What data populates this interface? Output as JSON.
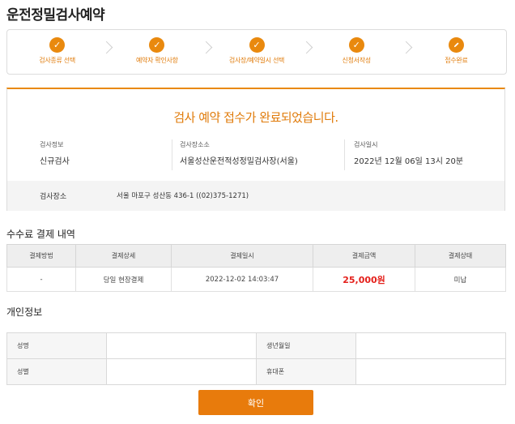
{
  "page_title": "운전정밀검사예약",
  "steps": [
    {
      "label": "검사종류 선택",
      "icon": "check-icon"
    },
    {
      "label": "예약자 확인사항",
      "icon": "check-icon"
    },
    {
      "label": "검사장/예약일시 선택",
      "icon": "check-icon"
    },
    {
      "label": "신청서작성",
      "icon": "check-icon"
    },
    {
      "label": "접수완료",
      "icon": "pencil-icon"
    }
  ],
  "result": {
    "headline": "검사 예약 접수가 완료되었습니다.",
    "info": [
      {
        "key": "검사정보",
        "value": "신규검사"
      },
      {
        "key": "검사장소소",
        "value": "서울성산운전적성정밀검사장(서울)"
      },
      {
        "key": "검사일시",
        "value": "2022년 12월 06일 13시 20분"
      }
    ],
    "location": {
      "key": "검사장소",
      "value": "서울 마포구 성산동 436-1 ((02)375-1271)"
    }
  },
  "payment": {
    "title": "수수료 결제 내역",
    "headers": [
      "결제방법",
      "결제상세",
      "결제일시",
      "결제금액",
      "결제상태"
    ],
    "row": [
      "-",
      "당일 현장결제",
      "2022-12-02 14:03:47",
      "25,000원",
      "미납"
    ]
  },
  "personal": {
    "title": "개인정보",
    "name_label": "성명",
    "name_value": "",
    "birth_label": "생년월일",
    "birth_value": "",
    "gender_label": "성별",
    "gender_value": "",
    "phone_label": "휴대폰",
    "phone_value": ""
  },
  "confirm_label": "확인",
  "colors": {
    "accent": "#e9890e",
    "amount": "#e4201b"
  }
}
